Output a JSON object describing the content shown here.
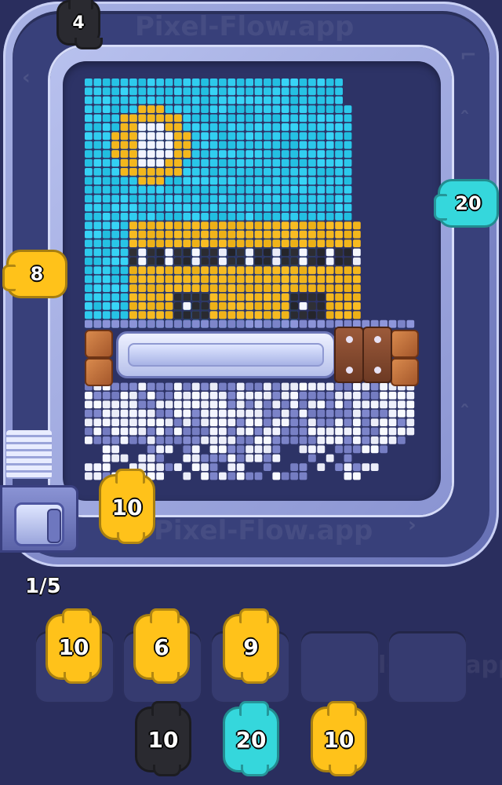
{
  "app": {
    "watermark_top": "Pixel-Flow.app",
    "watermark_bottom": "Pixel-Flow.app",
    "watermark_side": "Pixel-Flow.app",
    "watermark_center": "Pixel-Flow.app"
  },
  "colors": {
    "yellow": "#ffc21a",
    "cyan": "#35d7dc",
    "black": "#2a2a30",
    "board": "#2d3366",
    "sky": "#29c6e8",
    "bus": "#f4b71d",
    "snow_white": "#f2f4ff",
    "snow_blue": "#7b83c8"
  },
  "track_pigs": [
    {
      "id": "top-pig",
      "value": "4",
      "color": "black",
      "icon": "pig-icon"
    },
    {
      "id": "right-pig",
      "value": "20",
      "color": "cyan",
      "icon": "pig-icon"
    },
    {
      "id": "left-pig",
      "value": "8",
      "color": "yellow",
      "icon": "pig-icon"
    },
    {
      "id": "launch-pig",
      "value": "10",
      "color": "yellow",
      "icon": "pig-icon"
    }
  ],
  "progress": {
    "label": "1/5",
    "current": 1,
    "total": 5
  },
  "slots": [
    {
      "value": "10",
      "color": "yellow",
      "filled": true
    },
    {
      "value": "6",
      "color": "yellow",
      "filled": true
    },
    {
      "value": "9",
      "color": "yellow",
      "filled": true
    },
    {
      "value": "",
      "color": "",
      "filled": false
    },
    {
      "value": "",
      "color": "",
      "filled": false
    }
  ],
  "queue": [
    {
      "value": "10",
      "color": "black"
    },
    {
      "value": "20",
      "color": "cyan"
    },
    {
      "value": "10",
      "color": "yellow"
    }
  ],
  "artwork": {
    "subject": "school bus on snowy road under a sun",
    "icons": [
      "sun-icon",
      "bus-icon",
      "lock-icon",
      "wood-block-icon"
    ]
  }
}
